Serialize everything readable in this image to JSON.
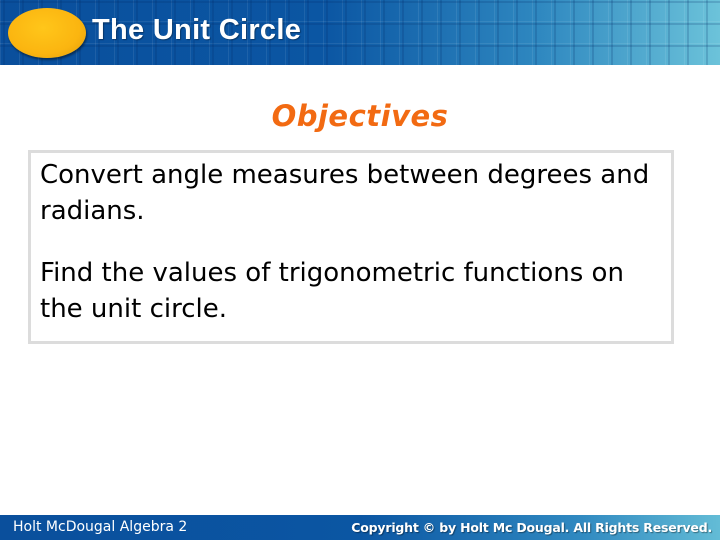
{
  "header": {
    "title": "The Unit Circle",
    "logo_icon": "orange-oval-logo",
    "colors": {
      "bar_start": "#0a4f9c",
      "bar_end": "#6cc3da",
      "logo": "#fbb510"
    }
  },
  "section": {
    "title": "Objectives",
    "title_color": "#f26a12"
  },
  "objectives": [
    "Convert angle measures between degrees and radians.",
    "Find the values of trigonometric functions on the unit circle."
  ],
  "footer": {
    "publisher": "Holt McDougal Algebra 2",
    "copyright": "Copyright © by Holt Mc Dougal. All Rights Reserved."
  }
}
